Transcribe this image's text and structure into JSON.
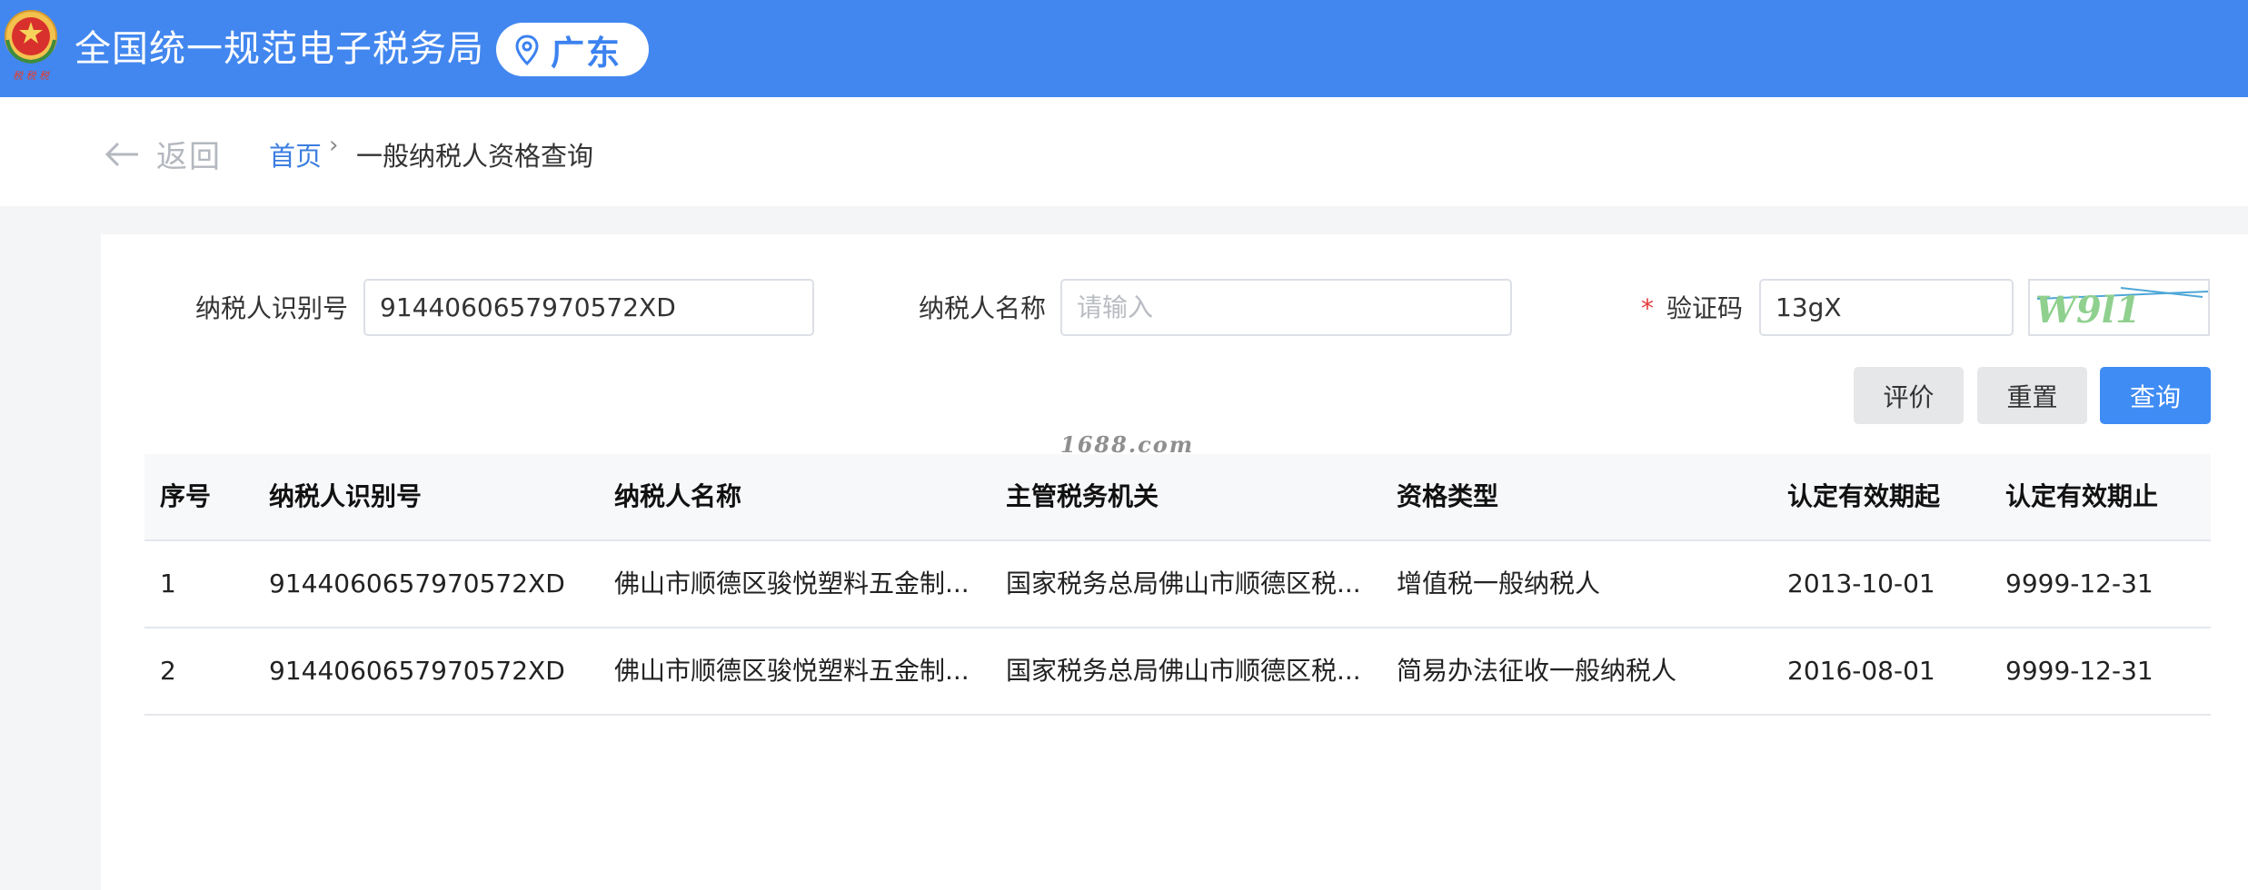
{
  "header": {
    "site_title": "全国统一规范电子税务局",
    "region": "广东",
    "emblem_icon": "tax-bureau-emblem",
    "pin_icon": "location-pin-icon",
    "brand_color": "#4287ef"
  },
  "breadcrumb": {
    "back_label": "返回",
    "home": "首页",
    "separator": "›",
    "current": "一般纳税人资格查询"
  },
  "form": {
    "taxpayer_id_label": "纳税人识别号",
    "taxpayer_id_value": "9144060657970572XD",
    "taxpayer_name_label": "纳税人名称",
    "taxpayer_name_placeholder": "请输入",
    "captcha_required_mark": "*",
    "captcha_label": "验证码",
    "captcha_value": "13gX",
    "captcha_image_text": "W9l1"
  },
  "buttons": {
    "evaluate": "评价",
    "reset": "重置",
    "query": "查询"
  },
  "watermark": "1688.com",
  "table": {
    "columns": [
      "序号",
      "纳税人识别号",
      "纳税人名称",
      "主管税务机关",
      "资格类型",
      "认定有效期起",
      "认定有效期止"
    ],
    "rows": [
      [
        "1",
        "9144060657970572XD",
        "佛山市顺德区骏悦塑料五金制...",
        "国家税务总局佛山市顺德区税...",
        "增值税一般纳税人",
        "2013-10-01",
        "9999-12-31"
      ],
      [
        "2",
        "9144060657970572XD",
        "佛山市顺德区骏悦塑料五金制...",
        "国家税务总局佛山市顺德区税...",
        "简易办法征收一般纳税人",
        "2016-08-01",
        "9999-12-31"
      ]
    ]
  }
}
